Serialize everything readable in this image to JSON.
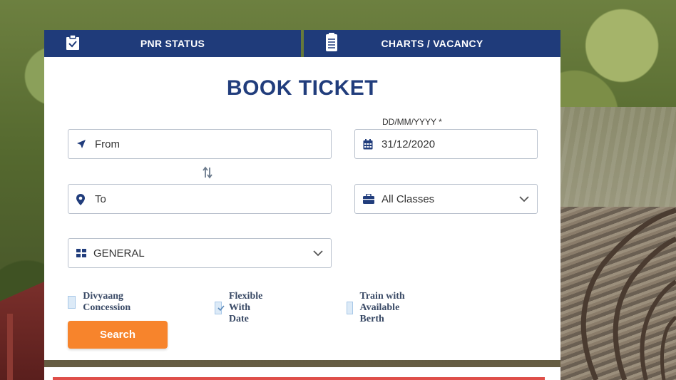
{
  "tabs": [
    {
      "label": "PNR STATUS",
      "icon": "clipboard-check-icon"
    },
    {
      "label": "CHARTS / VACANCY",
      "icon": "document-icon"
    }
  ],
  "form": {
    "title": "BOOK TICKET",
    "from": {
      "placeholder": "From",
      "icon": "location-arrow-icon"
    },
    "to": {
      "placeholder": "To",
      "icon": "map-marker-icon"
    },
    "swap_icon": "swap-vertical-icon",
    "date": {
      "label": "DD/MM/YYYY *",
      "value": "31/12/2020",
      "icon": "calendar-icon"
    },
    "class": {
      "value": "All Classes",
      "icon": "briefcase-icon"
    },
    "quota": {
      "value": "GENERAL",
      "icon": "grid-icon"
    },
    "checkboxes": [
      {
        "label": "Divyaang Concession",
        "checked": false
      },
      {
        "label": "Flexible With Date",
        "checked": true
      },
      {
        "label": "Train with Available Berth",
        "checked": false
      }
    ],
    "search_label": "Search"
  },
  "colors": {
    "navy": "#1f3b7a",
    "title": "#213d7c",
    "accent_orange": "#f7842c",
    "ticker_red": "#d9302a"
  }
}
